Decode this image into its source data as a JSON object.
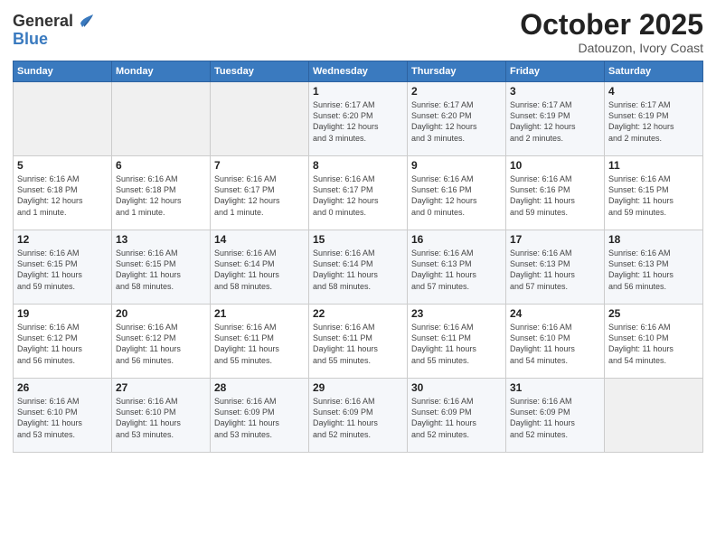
{
  "logo": {
    "general": "General",
    "blue": "Blue"
  },
  "header": {
    "month": "October 2025",
    "location": "Datouzon, Ivory Coast"
  },
  "weekdays": [
    "Sunday",
    "Monday",
    "Tuesday",
    "Wednesday",
    "Thursday",
    "Friday",
    "Saturday"
  ],
  "weeks": [
    [
      {
        "day": "",
        "info": ""
      },
      {
        "day": "",
        "info": ""
      },
      {
        "day": "",
        "info": ""
      },
      {
        "day": "1",
        "info": "Sunrise: 6:17 AM\nSunset: 6:20 PM\nDaylight: 12 hours\nand 3 minutes."
      },
      {
        "day": "2",
        "info": "Sunrise: 6:17 AM\nSunset: 6:20 PM\nDaylight: 12 hours\nand 3 minutes."
      },
      {
        "day": "3",
        "info": "Sunrise: 6:17 AM\nSunset: 6:19 PM\nDaylight: 12 hours\nand 2 minutes."
      },
      {
        "day": "4",
        "info": "Sunrise: 6:17 AM\nSunset: 6:19 PM\nDaylight: 12 hours\nand 2 minutes."
      }
    ],
    [
      {
        "day": "5",
        "info": "Sunrise: 6:16 AM\nSunset: 6:18 PM\nDaylight: 12 hours\nand 1 minute."
      },
      {
        "day": "6",
        "info": "Sunrise: 6:16 AM\nSunset: 6:18 PM\nDaylight: 12 hours\nand 1 minute."
      },
      {
        "day": "7",
        "info": "Sunrise: 6:16 AM\nSunset: 6:17 PM\nDaylight: 12 hours\nand 1 minute."
      },
      {
        "day": "8",
        "info": "Sunrise: 6:16 AM\nSunset: 6:17 PM\nDaylight: 12 hours\nand 0 minutes."
      },
      {
        "day": "9",
        "info": "Sunrise: 6:16 AM\nSunset: 6:16 PM\nDaylight: 12 hours\nand 0 minutes."
      },
      {
        "day": "10",
        "info": "Sunrise: 6:16 AM\nSunset: 6:16 PM\nDaylight: 11 hours\nand 59 minutes."
      },
      {
        "day": "11",
        "info": "Sunrise: 6:16 AM\nSunset: 6:15 PM\nDaylight: 11 hours\nand 59 minutes."
      }
    ],
    [
      {
        "day": "12",
        "info": "Sunrise: 6:16 AM\nSunset: 6:15 PM\nDaylight: 11 hours\nand 59 minutes."
      },
      {
        "day": "13",
        "info": "Sunrise: 6:16 AM\nSunset: 6:15 PM\nDaylight: 11 hours\nand 58 minutes."
      },
      {
        "day": "14",
        "info": "Sunrise: 6:16 AM\nSunset: 6:14 PM\nDaylight: 11 hours\nand 58 minutes."
      },
      {
        "day": "15",
        "info": "Sunrise: 6:16 AM\nSunset: 6:14 PM\nDaylight: 11 hours\nand 58 minutes."
      },
      {
        "day": "16",
        "info": "Sunrise: 6:16 AM\nSunset: 6:13 PM\nDaylight: 11 hours\nand 57 minutes."
      },
      {
        "day": "17",
        "info": "Sunrise: 6:16 AM\nSunset: 6:13 PM\nDaylight: 11 hours\nand 57 minutes."
      },
      {
        "day": "18",
        "info": "Sunrise: 6:16 AM\nSunset: 6:13 PM\nDaylight: 11 hours\nand 56 minutes."
      }
    ],
    [
      {
        "day": "19",
        "info": "Sunrise: 6:16 AM\nSunset: 6:12 PM\nDaylight: 11 hours\nand 56 minutes."
      },
      {
        "day": "20",
        "info": "Sunrise: 6:16 AM\nSunset: 6:12 PM\nDaylight: 11 hours\nand 56 minutes."
      },
      {
        "day": "21",
        "info": "Sunrise: 6:16 AM\nSunset: 6:11 PM\nDaylight: 11 hours\nand 55 minutes."
      },
      {
        "day": "22",
        "info": "Sunrise: 6:16 AM\nSunset: 6:11 PM\nDaylight: 11 hours\nand 55 minutes."
      },
      {
        "day": "23",
        "info": "Sunrise: 6:16 AM\nSunset: 6:11 PM\nDaylight: 11 hours\nand 55 minutes."
      },
      {
        "day": "24",
        "info": "Sunrise: 6:16 AM\nSunset: 6:10 PM\nDaylight: 11 hours\nand 54 minutes."
      },
      {
        "day": "25",
        "info": "Sunrise: 6:16 AM\nSunset: 6:10 PM\nDaylight: 11 hours\nand 54 minutes."
      }
    ],
    [
      {
        "day": "26",
        "info": "Sunrise: 6:16 AM\nSunset: 6:10 PM\nDaylight: 11 hours\nand 53 minutes."
      },
      {
        "day": "27",
        "info": "Sunrise: 6:16 AM\nSunset: 6:10 PM\nDaylight: 11 hours\nand 53 minutes."
      },
      {
        "day": "28",
        "info": "Sunrise: 6:16 AM\nSunset: 6:09 PM\nDaylight: 11 hours\nand 53 minutes."
      },
      {
        "day": "29",
        "info": "Sunrise: 6:16 AM\nSunset: 6:09 PM\nDaylight: 11 hours\nand 52 minutes."
      },
      {
        "day": "30",
        "info": "Sunrise: 6:16 AM\nSunset: 6:09 PM\nDaylight: 11 hours\nand 52 minutes."
      },
      {
        "day": "31",
        "info": "Sunrise: 6:16 AM\nSunset: 6:09 PM\nDaylight: 11 hours\nand 52 minutes."
      },
      {
        "day": "",
        "info": ""
      }
    ]
  ]
}
